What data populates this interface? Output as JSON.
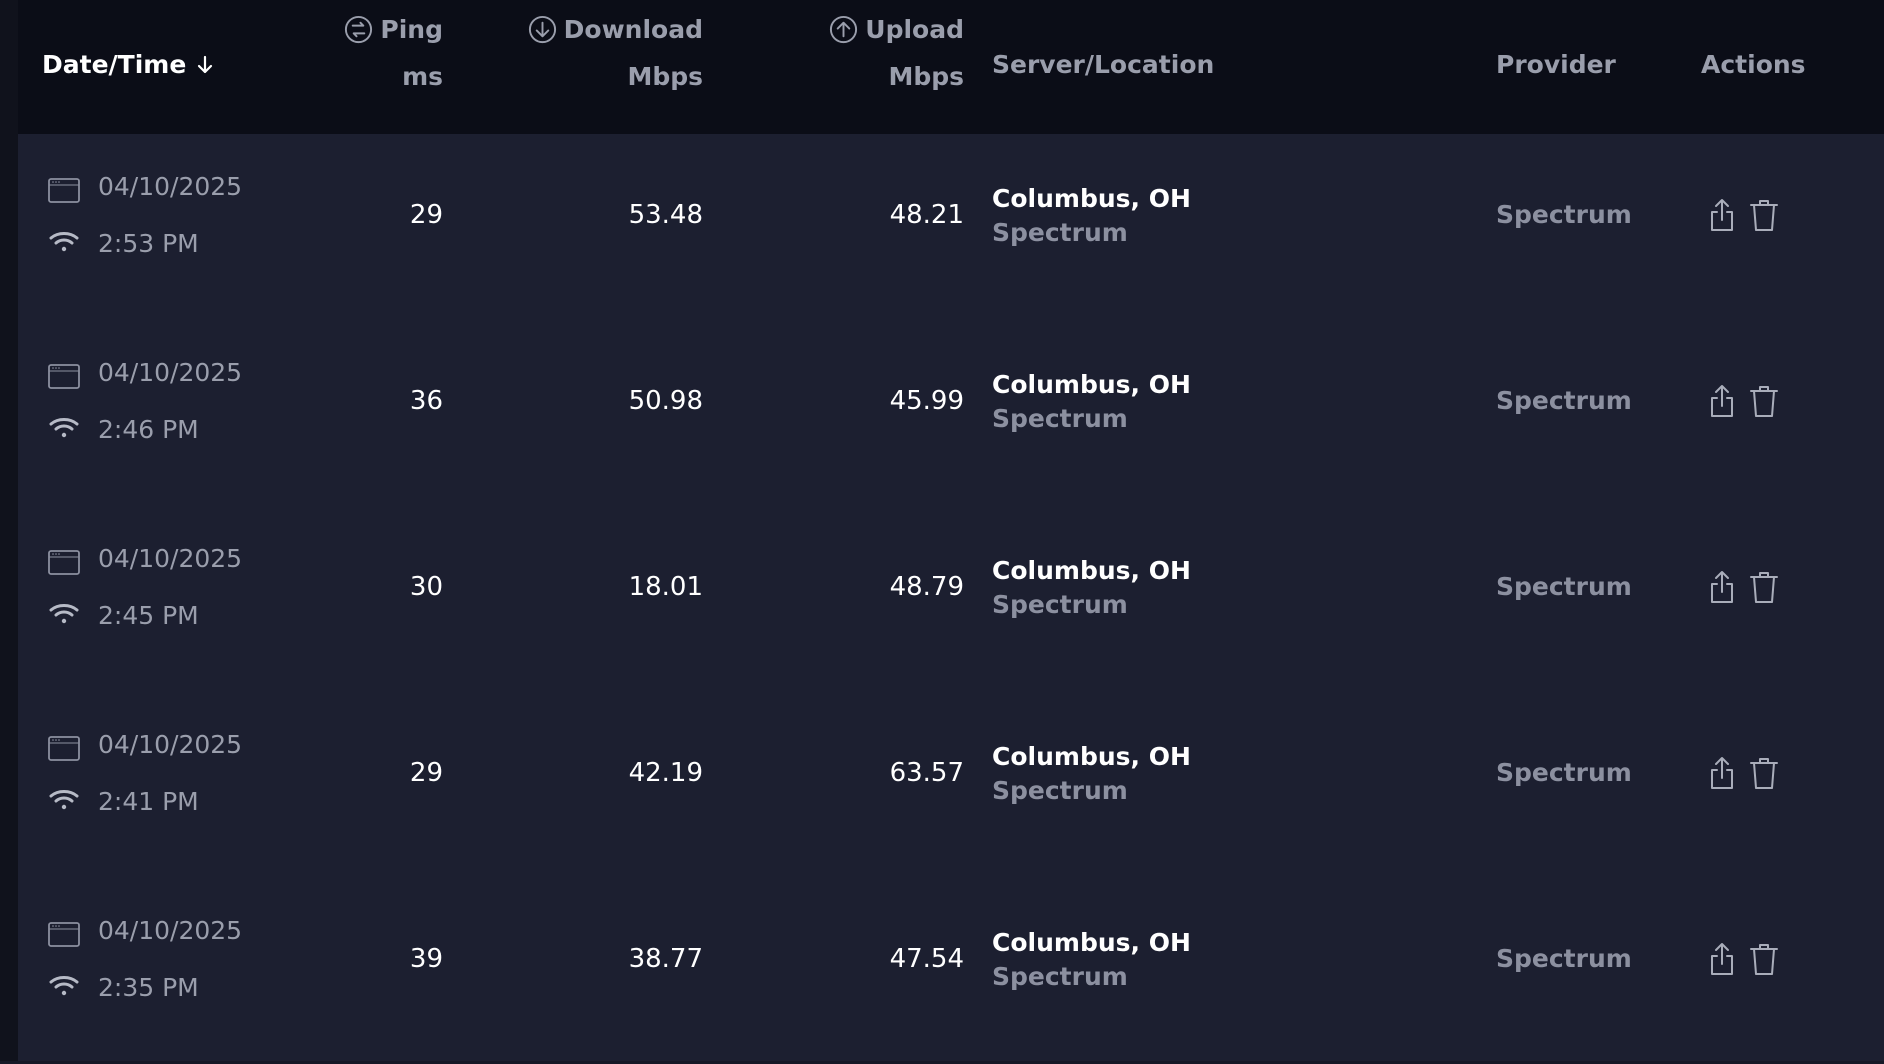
{
  "colors": {
    "header_bg": "#0b0d17",
    "row_bg": "#1c1f30",
    "text_primary": "#ffffff",
    "text_secondary": "#9a9eac",
    "icon": "#a9adba"
  },
  "header": {
    "date_time": "Date/Time",
    "ping": {
      "label": "Ping",
      "unit": "ms"
    },
    "download": {
      "label": "Download",
      "unit": "Mbps"
    },
    "upload": {
      "label": "Upload",
      "unit": "Mbps"
    },
    "server": "Server/Location",
    "provider": "Provider",
    "actions": "Actions"
  },
  "rows": [
    {
      "date": "04/10/2025",
      "time": "2:53 PM",
      "ping": "29",
      "download": "53.48",
      "upload": "48.21",
      "location": "Columbus, OH",
      "server": "Spectrum",
      "provider": "Spectrum"
    },
    {
      "date": "04/10/2025",
      "time": "2:46 PM",
      "ping": "36",
      "download": "50.98",
      "upload": "45.99",
      "location": "Columbus, OH",
      "server": "Spectrum",
      "provider": "Spectrum"
    },
    {
      "date": "04/10/2025",
      "time": "2:45 PM",
      "ping": "30",
      "download": "18.01",
      "upload": "48.79",
      "location": "Columbus, OH",
      "server": "Spectrum",
      "provider": "Spectrum"
    },
    {
      "date": "04/10/2025",
      "time": "2:41 PM",
      "ping": "29",
      "download": "42.19",
      "upload": "63.57",
      "location": "Columbus, OH",
      "server": "Spectrum",
      "provider": "Spectrum"
    },
    {
      "date": "04/10/2025",
      "time": "2:35 PM",
      "ping": "39",
      "download": "38.77",
      "upload": "47.54",
      "location": "Columbus, OH",
      "server": "Spectrum",
      "provider": "Spectrum"
    }
  ]
}
